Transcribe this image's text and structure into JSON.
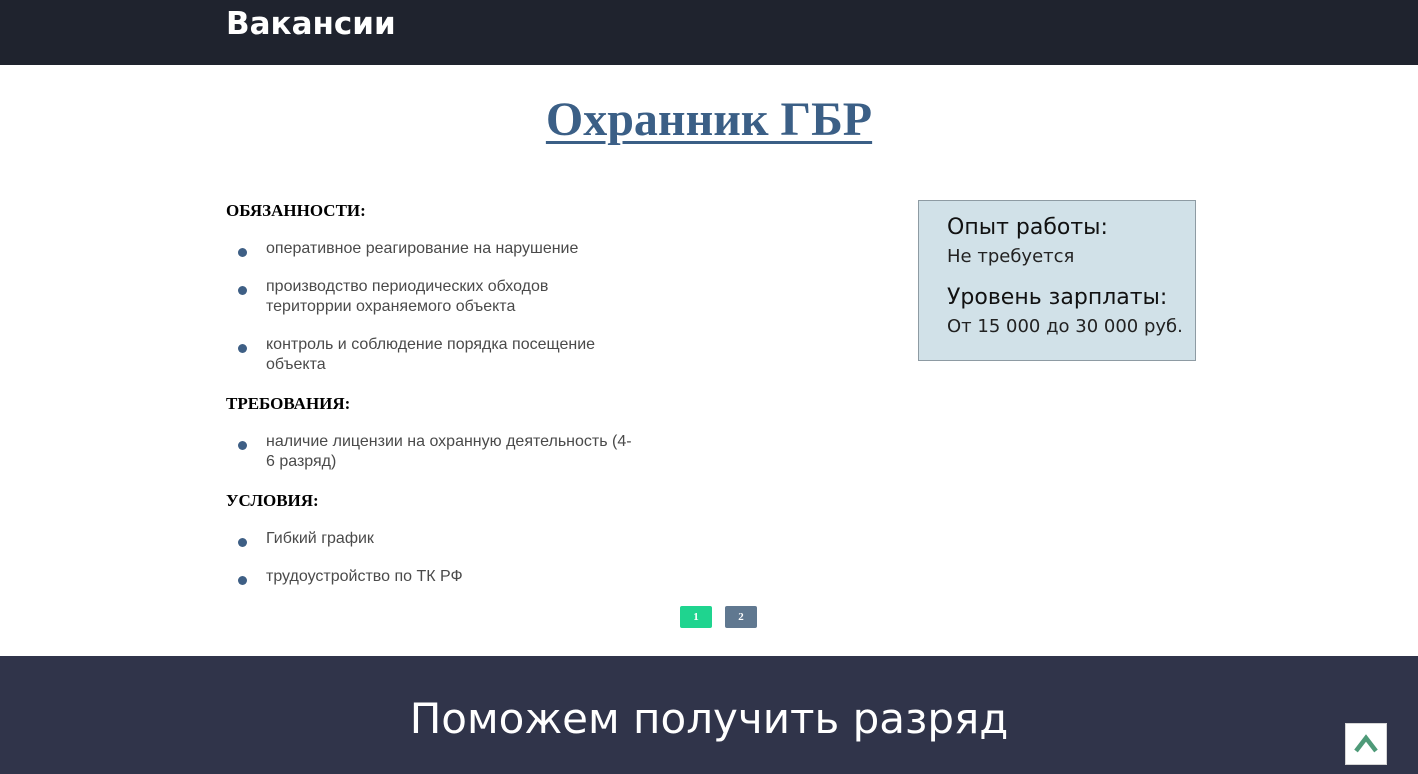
{
  "header": {
    "section_title": "Вакансии"
  },
  "vacancy": {
    "title": "Охранник ГБР",
    "duties_heading": "ОБЯЗАННОСТИ:",
    "duties": [
      "оперативное реагирование на нарушение",
      "производство периодических обходов територрии охраняемого объекта",
      "контроль и соблюдение порядка посещение объекта"
    ],
    "requirements_heading": "ТРЕБОВАНИЯ:",
    "requirements": [
      "наличие лицензии на охранную деятельность (4-6 разряд)"
    ],
    "conditions_heading": "УСЛОВИЯ:",
    "conditions": [
      "Гибкий график",
      "трудоустройство по ТК РФ"
    ]
  },
  "info": {
    "experience_label": "Опыт работы:",
    "experience_value": "Не требуется",
    "salary_label": "Уровень зарплаты:",
    "salary_value": "От 15 000 до 30 000 руб."
  },
  "pagination": {
    "pages": [
      "1",
      "2"
    ],
    "current": "1"
  },
  "footer_band": {
    "title": "Поможем получить разряд"
  },
  "icons": {
    "scroll_top": "chevron-up-icon"
  },
  "colors": {
    "topbar": "#1f232e",
    "title_link": "#3b5f86",
    "bullet": "#3e5f85",
    "info_box": "#d1e1e8",
    "page_active": "#1fd48f",
    "page_inactive": "#607890",
    "band": "#30344a",
    "scroll_arrow": "#4e9a78"
  }
}
